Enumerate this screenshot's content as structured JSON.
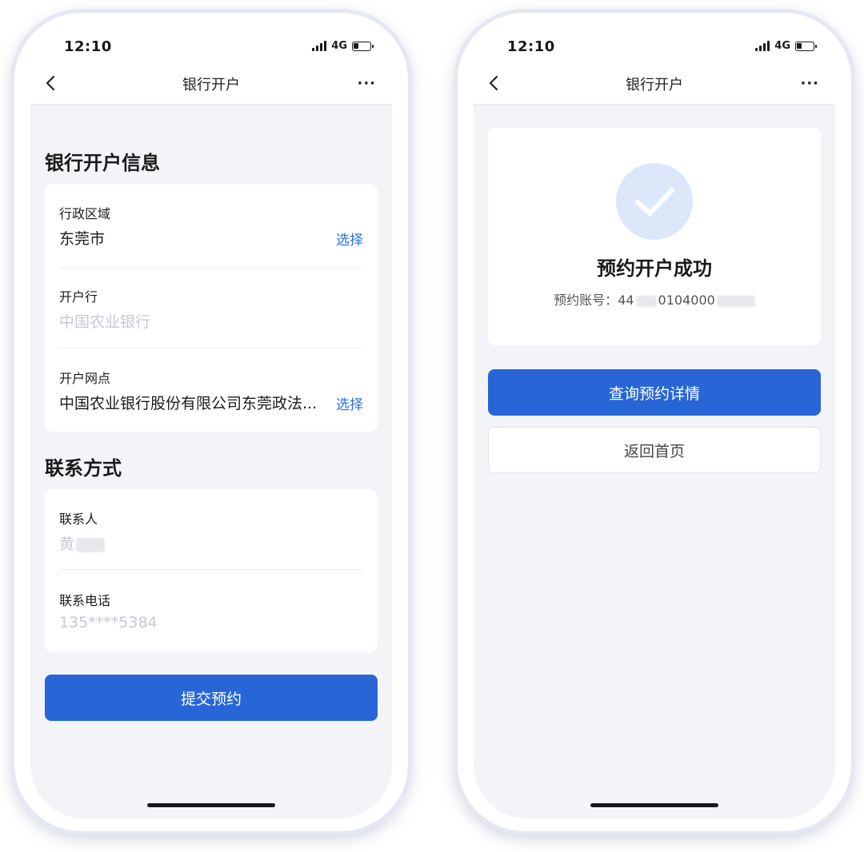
{
  "status_bar": {
    "time": "12:10",
    "network": "4G"
  },
  "left_screen": {
    "nav": {
      "title": "银行开户",
      "more": "···"
    },
    "bank_section": {
      "title": "银行开户信息",
      "region": {
        "label": "行政区域",
        "value": "东莞市",
        "action": "选择"
      },
      "bank": {
        "label": "开户行",
        "placeholder": "中国农业银行"
      },
      "branch": {
        "label": "开户网点",
        "value": "中国农业银行股份有限公司东莞政法...",
        "action": "选择"
      }
    },
    "contact_section": {
      "title": "联系方式",
      "person": {
        "label": "联系人",
        "placeholder": "黄"
      },
      "phone": {
        "label": "联系电话",
        "placeholder": "135****5384"
      }
    },
    "submit_label": "提交预约"
  },
  "right_screen": {
    "nav": {
      "title": "银行开户",
      "more": "···"
    },
    "success": {
      "title": "预约开户成功",
      "account_label": "预约账号：",
      "account_prefix": "44",
      "account_middle": "0104000"
    },
    "query_label": "查询预约详情",
    "home_label": "返回首页"
  },
  "colors": {
    "accent": "#2866d8",
    "link": "#2a6fdc",
    "background": "#f2f4f8",
    "check_circle": "#dde7fa"
  }
}
